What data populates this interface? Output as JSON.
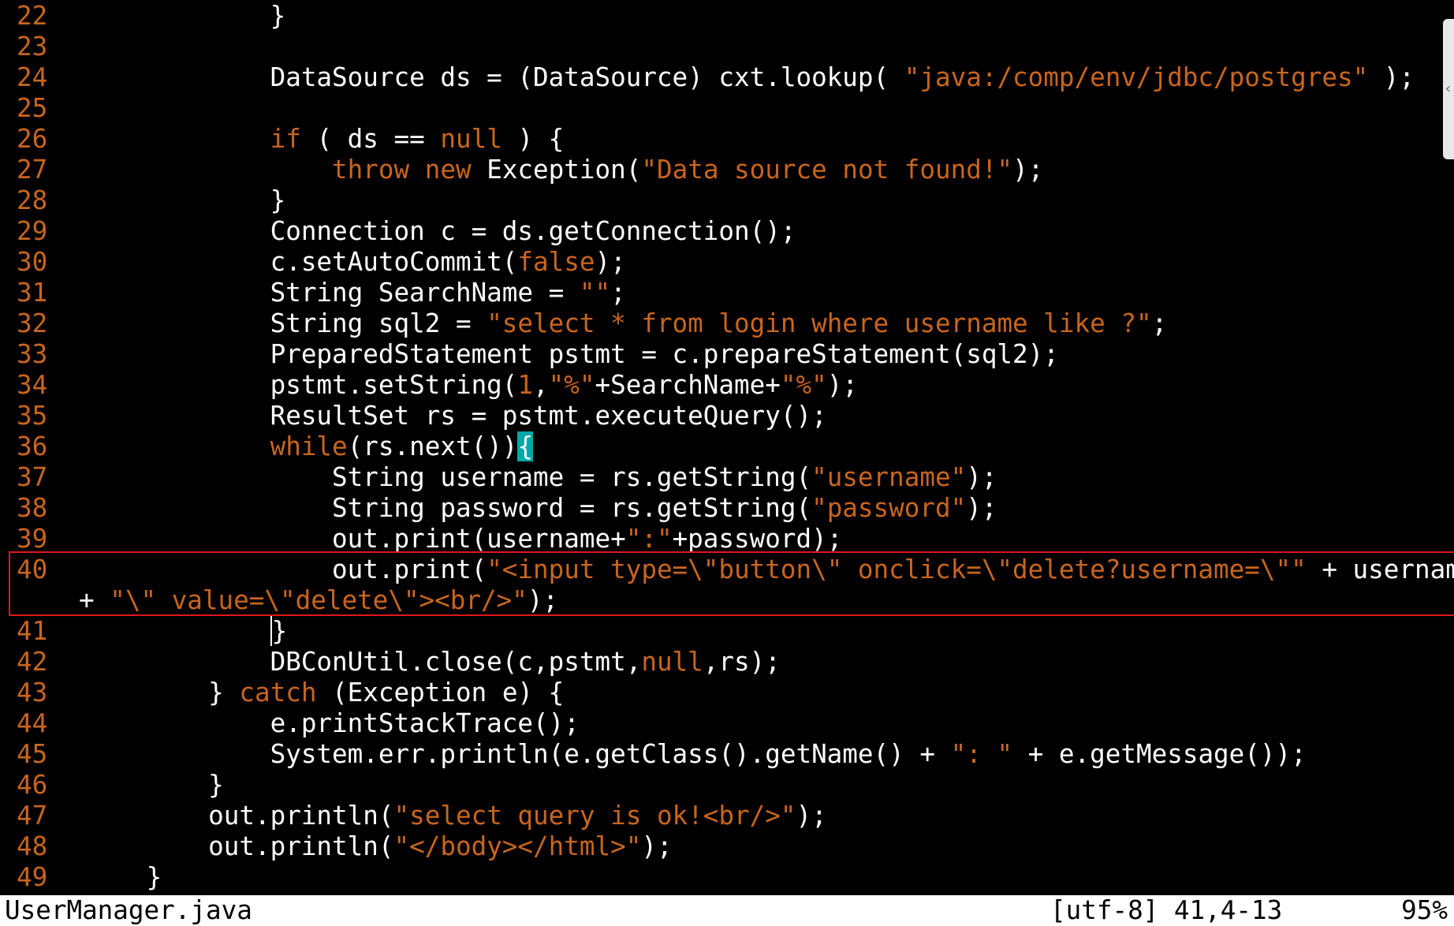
{
  "editor": {
    "lines": [
      {
        "n": "22",
        "tokens": [
          [
            "t",
            "              }"
          ]
        ]
      },
      {
        "n": "23",
        "tokens": []
      },
      {
        "n": "24",
        "tokens": [
          [
            "t",
            "              DataSource ds = (DataSource) cxt.lookup( "
          ],
          [
            "s",
            "\"java:/comp/env/jdbc/postgres\""
          ],
          [
            "t",
            " );"
          ]
        ]
      },
      {
        "n": "25",
        "tokens": []
      },
      {
        "n": "26",
        "tokens": [
          [
            "t",
            "              "
          ],
          [
            "k",
            "if"
          ],
          [
            "t",
            " ( ds == "
          ],
          [
            "k",
            "null"
          ],
          [
            "t",
            " ) {"
          ]
        ]
      },
      {
        "n": "27",
        "tokens": [
          [
            "t",
            "                  "
          ],
          [
            "k",
            "throw"
          ],
          [
            "t",
            " "
          ],
          [
            "k",
            "new"
          ],
          [
            "t",
            " Exception("
          ],
          [
            "s",
            "\"Data source not found!\""
          ],
          [
            "t",
            ");"
          ]
        ]
      },
      {
        "n": "28",
        "tokens": [
          [
            "t",
            "              }"
          ]
        ]
      },
      {
        "n": "29",
        "tokens": [
          [
            "t",
            "              Connection c = ds.getConnection();"
          ]
        ]
      },
      {
        "n": "30",
        "tokens": [
          [
            "t",
            "              c.setAutoCommit("
          ],
          [
            "k",
            "false"
          ],
          [
            "t",
            ");"
          ]
        ]
      },
      {
        "n": "31",
        "tokens": [
          [
            "t",
            "              String SearchName = "
          ],
          [
            "s",
            "\"\""
          ],
          [
            "t",
            ";"
          ]
        ]
      },
      {
        "n": "32",
        "tokens": [
          [
            "t",
            "              String sql2 = "
          ],
          [
            "s",
            "\"select * from login where username like ?\""
          ],
          [
            "t",
            ";"
          ]
        ]
      },
      {
        "n": "33",
        "tokens": [
          [
            "t",
            "              PreparedStatement pstmt = c.prepareStatement(sql2);"
          ]
        ]
      },
      {
        "n": "34",
        "tokens": [
          [
            "t",
            "              pstmt.setString("
          ],
          [
            "k",
            "1"
          ],
          [
            "t",
            ","
          ],
          [
            "s",
            "\"%\""
          ],
          [
            "t",
            "+SearchName+"
          ],
          [
            "s",
            "\"%\""
          ],
          [
            "t",
            ");"
          ]
        ]
      },
      {
        "n": "35",
        "tokens": [
          [
            "t",
            "              ResultSet rs = pstmt.executeQuery();"
          ]
        ]
      },
      {
        "n": "36",
        "tokens": [
          [
            "t",
            "              "
          ],
          [
            "k",
            "while"
          ],
          [
            "t",
            "(rs.next())"
          ],
          [
            "c",
            "{"
          ]
        ]
      },
      {
        "n": "37",
        "tokens": [
          [
            "t",
            "                  String username = rs.getString("
          ],
          [
            "s",
            "\"username\""
          ],
          [
            "t",
            ");"
          ]
        ]
      },
      {
        "n": "38",
        "tokens": [
          [
            "t",
            "                  String password = rs.getString("
          ],
          [
            "s",
            "\"password\""
          ],
          [
            "t",
            ");"
          ]
        ]
      },
      {
        "n": "39",
        "tokens": [
          [
            "t",
            "                  out.print(username+"
          ],
          [
            "s",
            "\":\""
          ],
          [
            "t",
            "+password);"
          ]
        ]
      },
      {
        "n": "40",
        "tokens": [
          [
            "t",
            "                  out.print("
          ],
          [
            "s",
            "\"<input type=\\\"button\\\" onclick=\\\"delete?username=\\\"\""
          ],
          [
            "t",
            " + username"
          ]
        ]
      },
      {
        "n": "",
        "tokens": [
          [
            "t",
            "+ "
          ],
          [
            "s",
            "\"\\\" value=\\\"delete\\\"><br/>\""
          ],
          [
            "t",
            ");"
          ]
        ]
      },
      {
        "n": "41",
        "tokens": [
          [
            "t",
            "              "
          ],
          [
            "c",
            "}"
          ]
        ]
      },
      {
        "n": "42",
        "tokens": [
          [
            "t",
            "              DBConUtil.close(c,pstmt,"
          ],
          [
            "k",
            "null"
          ],
          [
            "t",
            ",rs);"
          ]
        ]
      },
      {
        "n": "43",
        "tokens": [
          [
            "t",
            "          } "
          ],
          [
            "k",
            "catch"
          ],
          [
            "t",
            " (Exception e) {"
          ]
        ]
      },
      {
        "n": "44",
        "tokens": [
          [
            "t",
            "              e.printStackTrace();"
          ]
        ]
      },
      {
        "n": "45",
        "tokens": [
          [
            "t",
            "              System.err.println(e.getClass().getName() + "
          ],
          [
            "s",
            "\": \""
          ],
          [
            "t",
            " + e.getMessage());"
          ]
        ]
      },
      {
        "n": "46",
        "tokens": [
          [
            "t",
            "          }"
          ]
        ]
      },
      {
        "n": "47",
        "tokens": [
          [
            "t",
            "          out.println("
          ],
          [
            "s",
            "\"select query is ok!<br/>\""
          ],
          [
            "t",
            ");"
          ]
        ]
      },
      {
        "n": "48",
        "tokens": [
          [
            "t",
            "          out.println("
          ],
          [
            "s",
            "\"</body></html>\""
          ],
          [
            "t",
            ");"
          ]
        ]
      },
      {
        "n": "49",
        "tokens": [
          [
            "t",
            "      }"
          ]
        ]
      }
    ]
  },
  "statusbar": {
    "filename": "UserManager.java",
    "position": "[utf-8] 41,4-13",
    "percent": "95%"
  },
  "colors": {
    "background": "#000000",
    "keyword": "#c8651e",
    "string": "#c8651e",
    "cursor": "#00a8a8",
    "highlight_box": "#e0161d"
  }
}
